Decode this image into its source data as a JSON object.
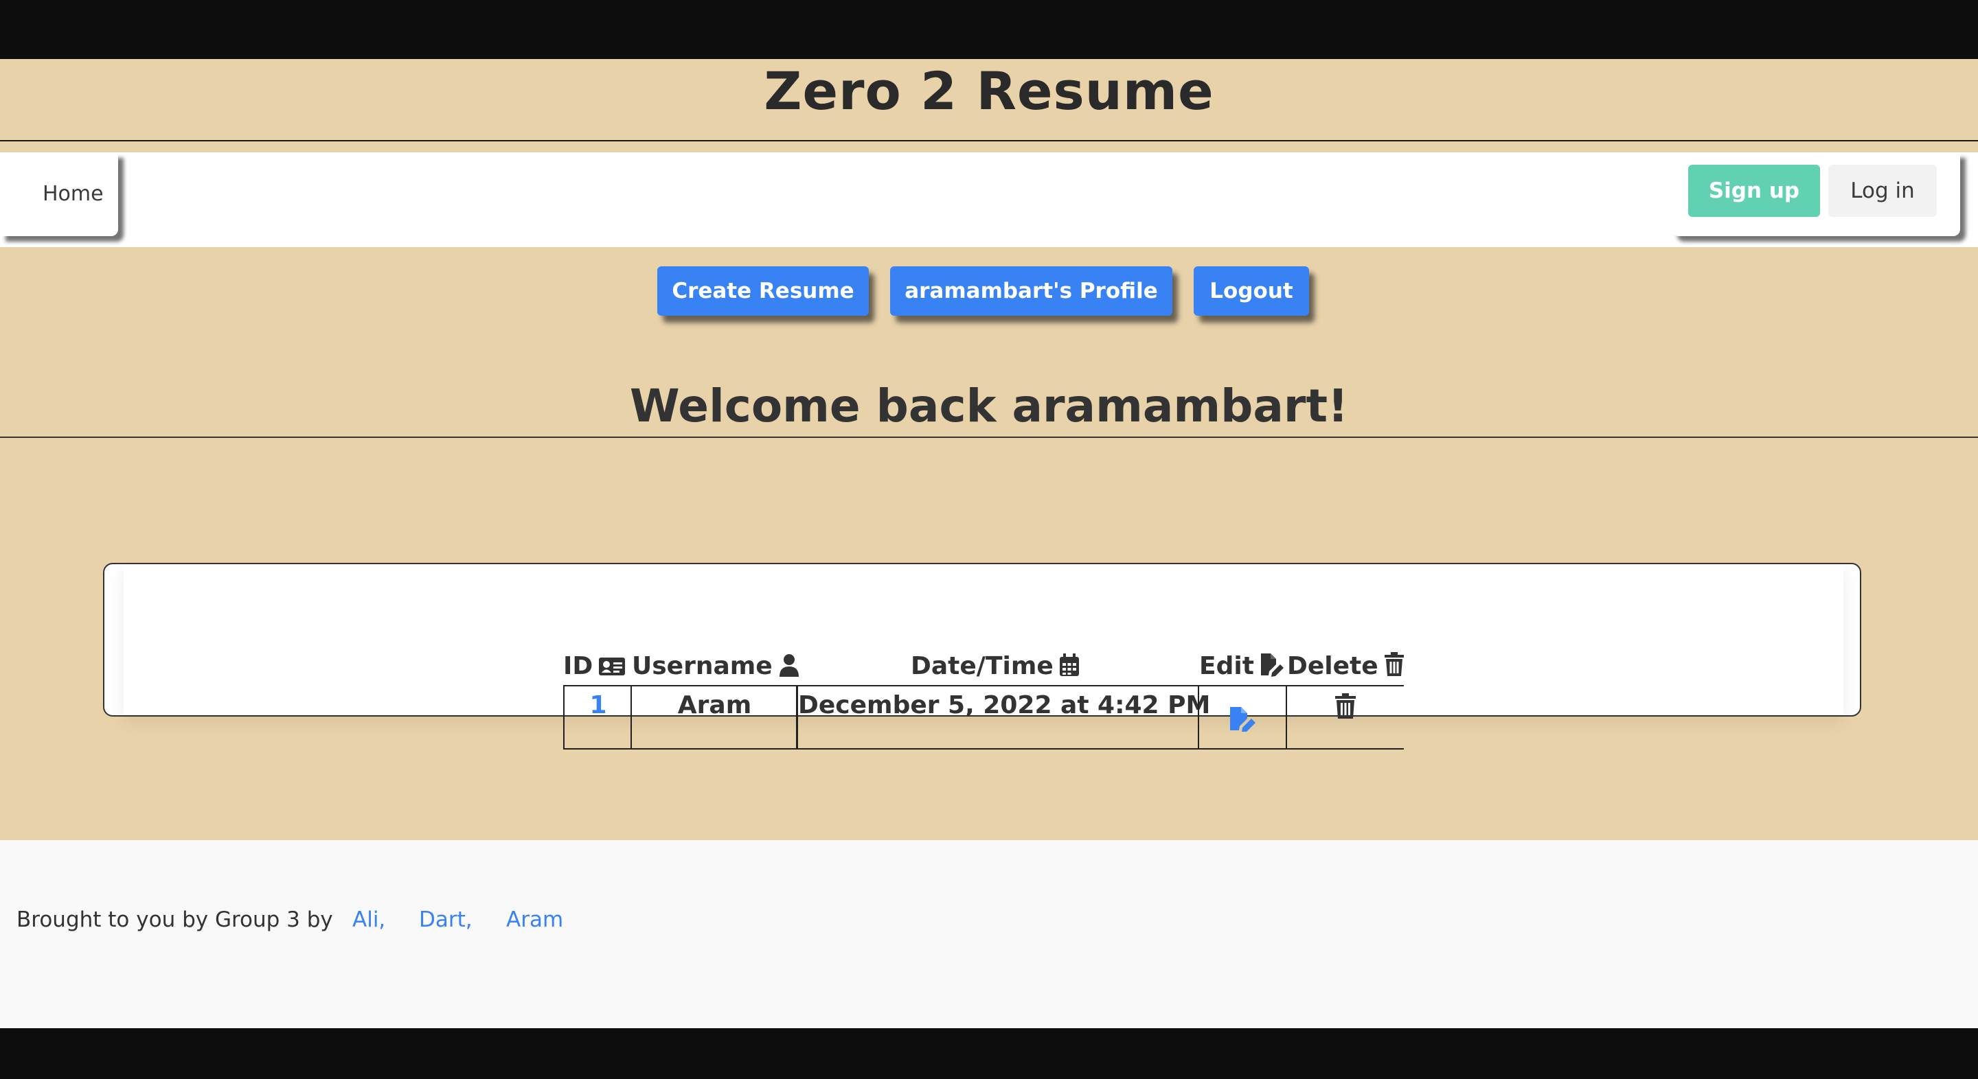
{
  "site": {
    "title": "Zero 2 Resume"
  },
  "navbar": {
    "home_label": "Home",
    "signup_label": "Sign up",
    "login_label": "Log in"
  },
  "actions": {
    "create_label": "Create Resume",
    "profile_label": "aramambart's Profile",
    "logout_label": "Logout"
  },
  "welcome": {
    "text": "Welcome back aramambart!"
  },
  "table": {
    "headers": {
      "id": "ID",
      "username": "Username",
      "datetime": "Date/Time",
      "edit": "Edit",
      "delete": "Delete"
    },
    "rows": [
      {
        "id": "1",
        "username": "Aram",
        "datetime": "December 5, 2022 at 4:42 PM"
      }
    ]
  },
  "footer": {
    "text": "Brought to you by Group 3 by",
    "links": [
      "Ali,",
      "Dart,",
      "Aram"
    ]
  },
  "colors": {
    "page_bg": "#e8d2aa",
    "primary": "#3882f4",
    "signup": "#62d1b2"
  },
  "icons": {
    "id": "id-card-icon",
    "username": "user-icon",
    "datetime": "calendar-icon",
    "edit": "file-edit-icon",
    "delete": "trash-icon"
  }
}
